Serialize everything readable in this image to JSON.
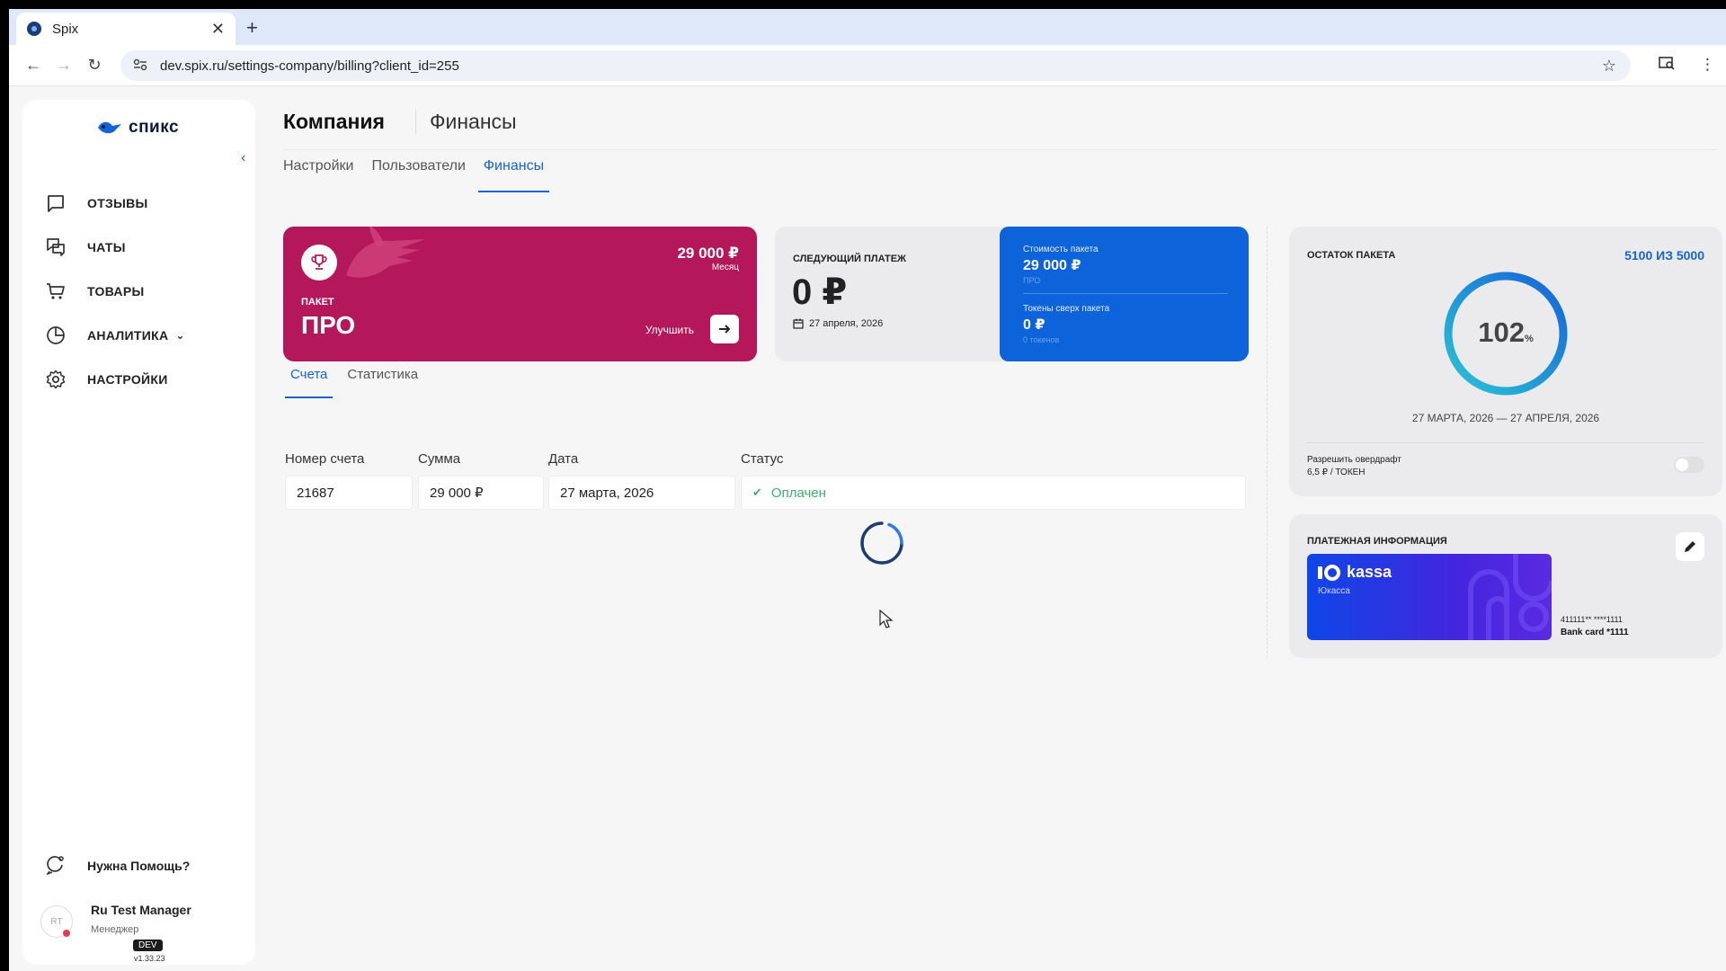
{
  "browser": {
    "tab_title": "Spix",
    "tab_close": "✕",
    "new_tab": "+",
    "url": "dev.spix.ru/settings-company/billing?client_id=255"
  },
  "sidebar": {
    "logo_text": "спикс",
    "items": [
      {
        "label": "ОТЗЫВЫ",
        "icon": "message-square-icon"
      },
      {
        "label": "ЧАТЫ",
        "icon": "chats-icon"
      },
      {
        "label": "ТОВАРЫ",
        "icon": "cart-icon"
      },
      {
        "label": "АНАЛИТИКА",
        "icon": "pie-chart-icon"
      },
      {
        "label": "НАСТРОЙКИ",
        "icon": "gear-icon"
      }
    ],
    "help": "Нужна Помощь?",
    "user": {
      "initials": "RT",
      "name": "Ru Test Manager",
      "role": "Менеджер"
    },
    "env_badge": "DEV",
    "version": "v1.33.23"
  },
  "header": {
    "title": "Компания",
    "subtitle": "Финансы"
  },
  "tabs": [
    "Настройки",
    "Пользователи",
    "Финансы"
  ],
  "package_card": {
    "price": "29 000 ₽",
    "period": "Месяц",
    "label": "ПАКЕТ",
    "name": "ПРО",
    "upgrade": "Улучшить",
    "color": "#b5185a"
  },
  "next_payment": {
    "label": "СЛЕДУЮЩИЙ ПЛАТЕЖ",
    "amount": "0 ₽",
    "date": "27 апреля, 2026",
    "cost_label": "Стоимость пакета",
    "cost_value": "29 000 ₽",
    "cost_sub": "ПРО",
    "tokens_label": "Токены сверх пакета",
    "tokens_value": "0 ₽",
    "tokens_sub": "0 токенов"
  },
  "subtabs": [
    "Счета",
    "Статистика"
  ],
  "invoices": {
    "columns": [
      "Номер счета",
      "Сумма",
      "Дата",
      "Статус"
    ],
    "rows": [
      {
        "number": "21687",
        "sum": "29 000 ₽",
        "date": "27 марта, 2026",
        "status": "Оплачен"
      }
    ]
  },
  "balance": {
    "label": "ОСТАТОК ПАКЕТА",
    "count": "5100 ИЗ 5000",
    "percent": "102",
    "percent_sign": "%",
    "progress": 1.0,
    "period": "27 МАРТА, 2026 — 27 АПРЕЛЯ, 2026",
    "overdraft_label": "Разрешить овердрафт",
    "overdraft_price": "6,5 ₽ / ТОКЕН",
    "overdraft_enabled": false
  },
  "payment_info": {
    "label": "ПЛАТЕЖНАЯ ИНФОРМАЦИЯ",
    "provider_logo": "kassa",
    "provider_name": "Юкасса",
    "card_mask": "411111** ****1111",
    "card_name": "Bank card *1111"
  }
}
